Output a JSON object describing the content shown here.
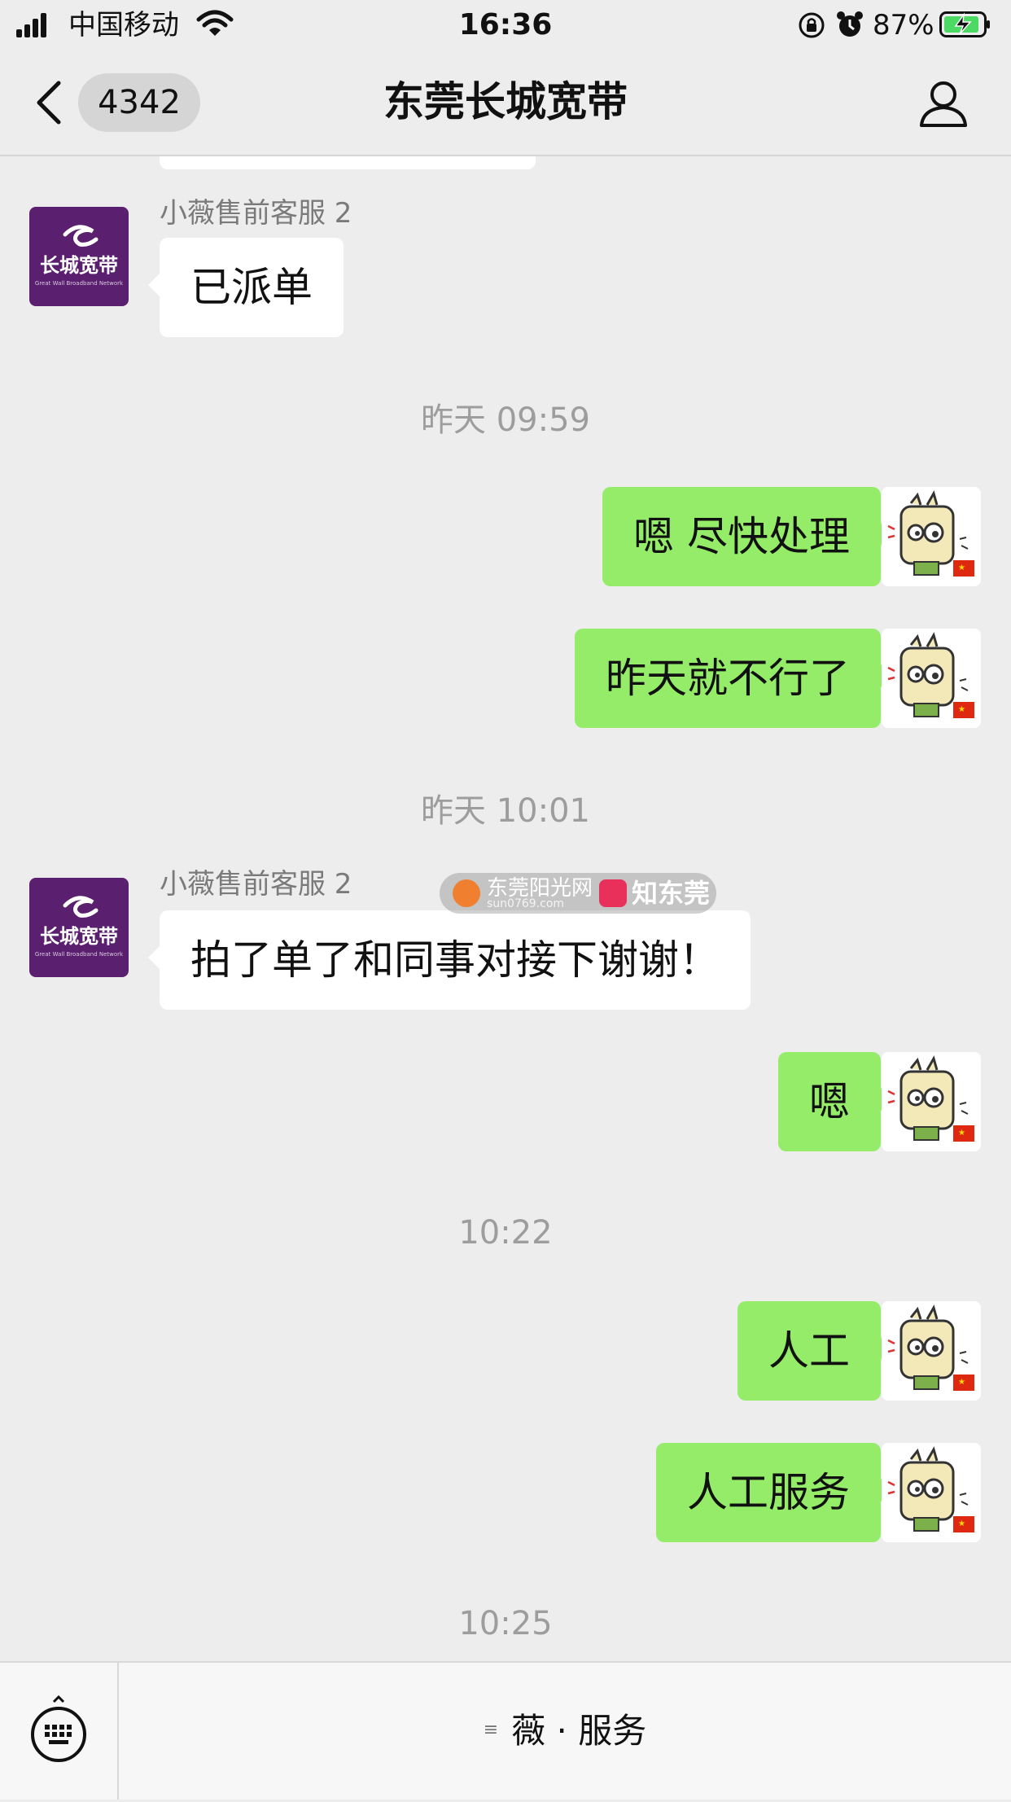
{
  "status_bar": {
    "carrier": "中国移动",
    "time": "16:36",
    "battery": "87%"
  },
  "nav": {
    "unread_count": "4342",
    "title": "东莞长城宽带"
  },
  "chat": {
    "messages": [
      {
        "type": "in",
        "sender": "小薇售前客服 2",
        "text": "已派单"
      },
      {
        "type": "time",
        "text": "昨天 09:59"
      },
      {
        "type": "out",
        "text": "嗯 尽快处理"
      },
      {
        "type": "out",
        "text": "昨天就不行了"
      },
      {
        "type": "time",
        "text": "昨天 10:01"
      },
      {
        "type": "in",
        "sender": "小薇售前客服 2",
        "text": "拍了单了和同事对接下谢谢！"
      },
      {
        "type": "out",
        "text": "嗯"
      },
      {
        "type": "time",
        "text": "10:22"
      },
      {
        "type": "out",
        "text": "人工"
      },
      {
        "type": "out",
        "text": "人工服务"
      },
      {
        "type": "time",
        "text": "10:25"
      }
    ],
    "brand_avatar": {
      "text": "长城宽带",
      "subtext": "Great Wall Broadband Network"
    },
    "watermark": {
      "text1": "东莞阳光网",
      "sub": "sun0769.com",
      "text2": "知东莞"
    }
  },
  "bottom_bar": {
    "menu_label": "薇 · 服务",
    "menu_icon": "≡"
  },
  "colors": {
    "background": "#ededed",
    "out_bubble": "#95ec69",
    "in_bubble": "#ffffff",
    "brand_purple": "#5a1f6e",
    "timestamp": "#9d9d9d"
  }
}
